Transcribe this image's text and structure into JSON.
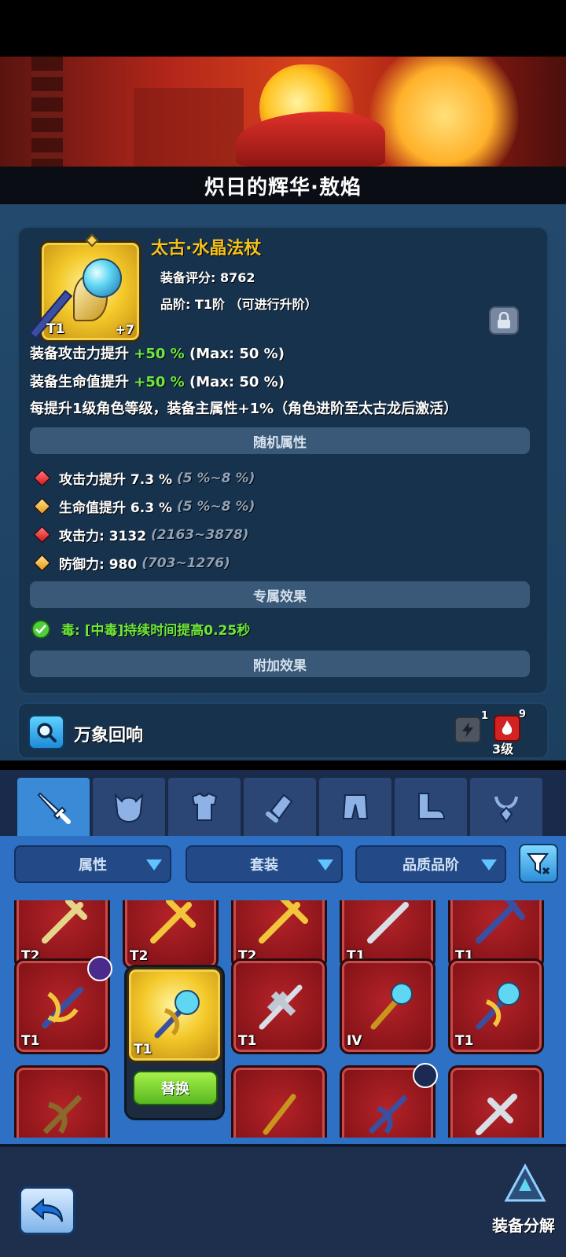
{
  "banner": {
    "title": "炽日的辉华·敖焰"
  },
  "item": {
    "name": "太古·水晶法杖",
    "score_label": "装备评分: 8762",
    "grade_label": "品阶: T1阶 （可进行升阶）",
    "tier": "T1",
    "enhance": "+7"
  },
  "bonuses": [
    {
      "label": "装备攻击力提升 ",
      "value": "+50 %",
      "max": " (Max: 50 %)"
    },
    {
      "label": "装备生命值提升 ",
      "value": "+50 %",
      "max": " (Max: 50 %)"
    }
  ],
  "level_note": "每提升1级角色等级，装备主属性+1%（角色进阶至太古龙后激活）",
  "sections": {
    "random": "随机属性",
    "exclusive": "专属效果",
    "additional": "附加效果"
  },
  "random_attrs": [
    {
      "text": "攻击力提升 7.3 %",
      "range": "(5 %~8 %)",
      "color": "#d4141c"
    },
    {
      "text": "生命值提升 6.3 %",
      "range": "(5 %~8 %)",
      "color": "#e39a14"
    },
    {
      "text": "攻击力: 3132",
      "range": "(2163~3878)",
      "color": "#d4141c"
    },
    {
      "text": "防御力: 980",
      "range": "(703~1276)",
      "color": "#e39a14"
    }
  ],
  "exclusive_effect": "毒: [中毒]持续时间提高0.25秒",
  "echo": {
    "label": "万象回响",
    "gray_count": "1",
    "red_count": "9",
    "level": "3级"
  },
  "tabs": [
    "weapon",
    "helmet",
    "armor",
    "bracer",
    "pants",
    "boots",
    "accessory"
  ],
  "filters": {
    "attribute": "属性",
    "set": "套装",
    "quality": "品质品阶"
  },
  "grid": {
    "row1": [
      "T2",
      "T2",
      "T2",
      "T1",
      "T1"
    ],
    "row2": [
      "T1",
      "T1",
      "T1",
      "IV",
      "T1"
    ],
    "replace_label": "替换"
  },
  "bottom": {
    "dismantle_label": "装备分解"
  }
}
